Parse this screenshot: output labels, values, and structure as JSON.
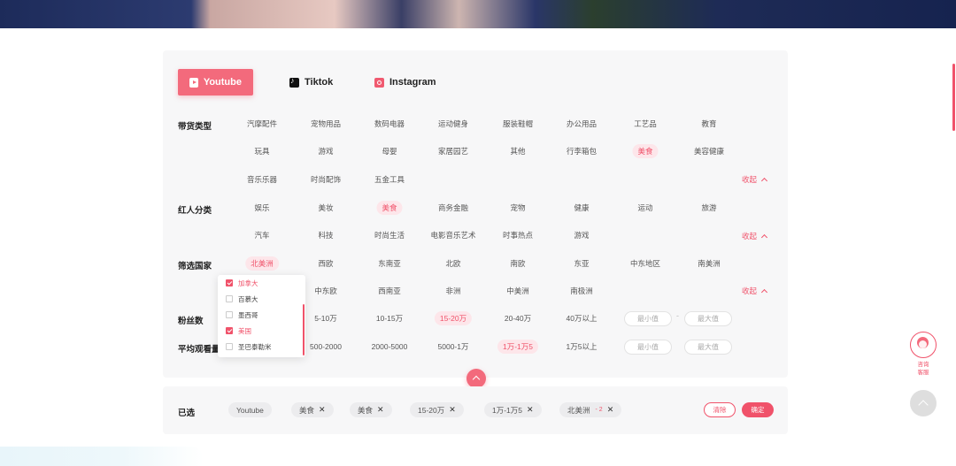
{
  "platform_tabs": [
    {
      "label": "Youtube",
      "icon": "youtube-icon",
      "active": true
    },
    {
      "label": "Tiktok",
      "icon": "tiktok-icon",
      "active": false
    },
    {
      "label": "Instagram",
      "icon": "instagram-icon",
      "active": false
    }
  ],
  "filters": {
    "goods_type": {
      "label": "带货类型",
      "rows": [
        [
          "汽摩配件",
          "宠物用品",
          "数码电器",
          "运动健身",
          "服装鞋帽",
          "办公用品",
          "工艺品",
          "教育"
        ],
        [
          "玩具",
          "游戏",
          "母婴",
          "家居园艺",
          "其他",
          "行李箱包",
          "美食",
          "美容健康"
        ],
        [
          "音乐乐器",
          "时尚配饰",
          "五金工具"
        ]
      ],
      "selected": [
        "美食"
      ],
      "collapse_label": "收起"
    },
    "influencer_category": {
      "label": "红人分类",
      "rows": [
        [
          "娱乐",
          "美妆",
          "美食",
          "商务金融",
          "宠物",
          "健康",
          "运动",
          "旅游"
        ],
        [
          "汽车",
          "科技",
          "时尚生活",
          "电影音乐艺术",
          "时事热点",
          "游戏"
        ]
      ],
      "selected": [
        "美食"
      ],
      "collapse_label": "收起"
    },
    "country": {
      "label": "筛选国家",
      "rows": [
        [
          "北美洲",
          "西欧",
          "东南亚",
          "北欧",
          "南欧",
          "东亚",
          "中东地区",
          "南美洲"
        ],
        [
          "中东欧",
          "西南亚",
          "非洲",
          "中美洲",
          "南极洲"
        ]
      ],
      "selected": [
        "北美洲"
      ],
      "collapse_label": "收起",
      "dropdown": [
        {
          "label": "加拿大",
          "checked": true
        },
        {
          "label": "百慕大",
          "checked": false
        },
        {
          "label": "墨西哥",
          "checked": false
        },
        {
          "label": "美国",
          "checked": true
        },
        {
          "label": "圣巴泰勒米",
          "checked": false
        }
      ]
    },
    "followers": {
      "label": "粉丝数",
      "options": [
        "5-10万",
        "10-15万",
        "15-20万",
        "20-40万",
        "40万以上"
      ],
      "selected": [
        "15-20万"
      ],
      "min_placeholder": "最小值",
      "max_placeholder": "最大值",
      "separator": "-"
    },
    "avg_views": {
      "label": "平均观看量",
      "options": [
        "500-2000",
        "2000-5000",
        "5000-1万",
        "1万-1万5",
        "1万5以上"
      ],
      "selected": [
        "1万-1万5"
      ],
      "min_placeholder": "最小值",
      "max_placeholder": "最大值"
    }
  },
  "selected_bar": {
    "label": "已选",
    "chips": [
      {
        "label": "Youtube",
        "removable": false
      },
      {
        "label": "美食",
        "removable": true
      },
      {
        "label": "美食",
        "removable": true
      },
      {
        "label": "15-20万",
        "removable": true
      },
      {
        "label": "1万-1万5",
        "removable": true
      },
      {
        "label": "北美洲",
        "count": "- 2",
        "removable": true
      }
    ],
    "clear_label": "清除",
    "confirm_label": "确定"
  },
  "side": {
    "service_label_1": "咨询",
    "service_label_2": "客服"
  },
  "colors": {
    "accent": "#f0526a",
    "accent_light": "#fde6ea",
    "panel_bg": "#f7f7f8"
  }
}
